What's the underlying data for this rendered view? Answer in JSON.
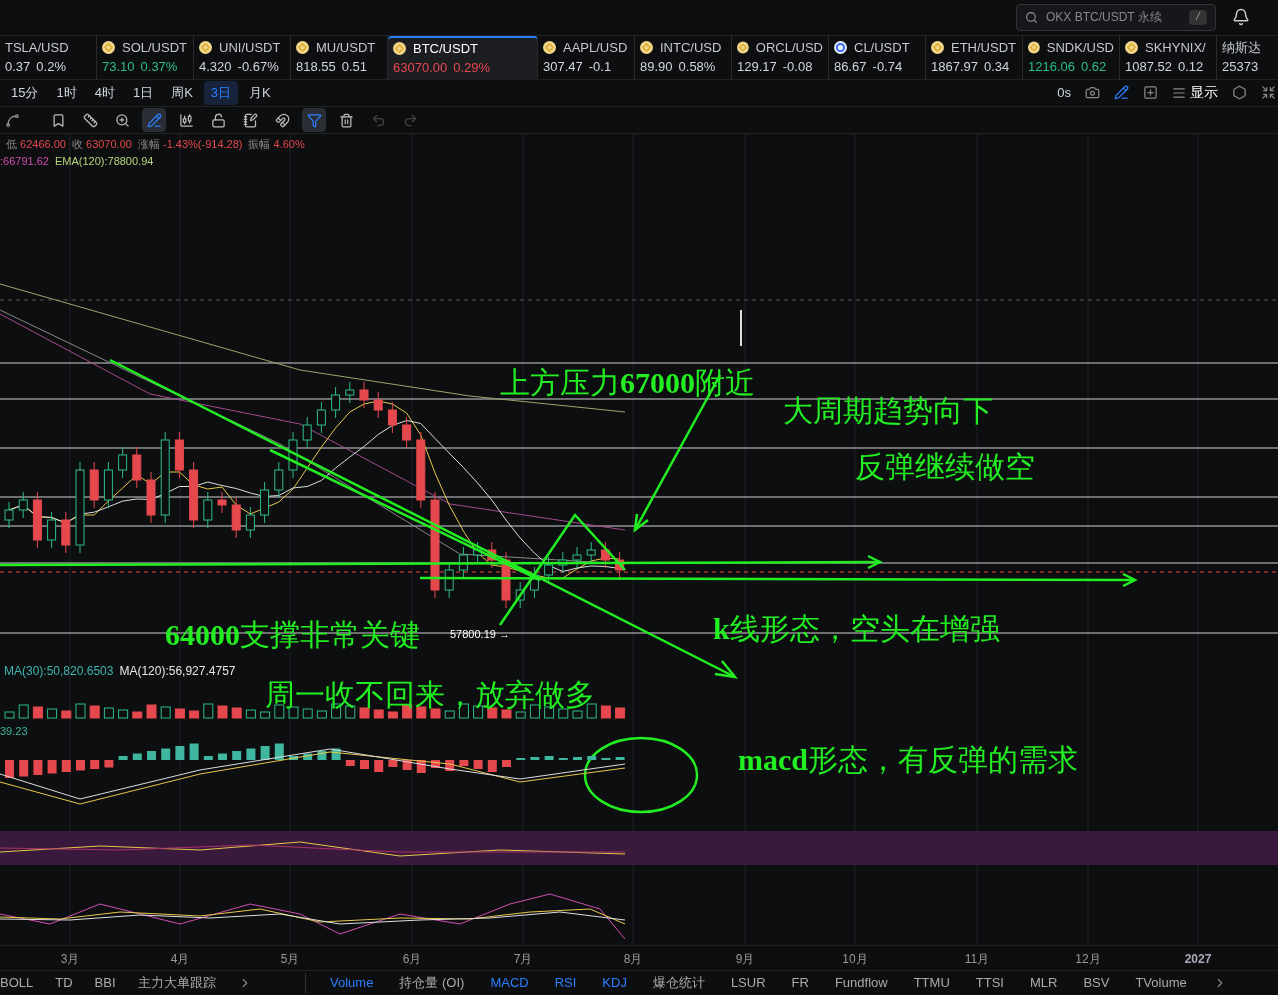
{
  "search": {
    "placeholder": "OKX BTC/USDT 永续",
    "shortcut": "/"
  },
  "tickers": [
    {
      "kind": "plain",
      "symbol": "TSLA/USD",
      "price": "0.37",
      "change": "0.2%",
      "selected": false,
      "color": "#d1d4dc"
    },
    {
      "kind": "coin",
      "symbol": "SOL/USDT",
      "price": "73.10",
      "change": "0.37%",
      "selected": false,
      "color": "#2ebd85"
    },
    {
      "kind": "coin",
      "symbol": "UNI/USDT",
      "price": "4.320",
      "change": "-0.67%",
      "selected": false,
      "color": "#d1d4dc"
    },
    {
      "kind": "coin",
      "symbol": "MU/USDT",
      "price": "818.55",
      "change": "0.51",
      "selected": false,
      "color": "#d1d4dc"
    },
    {
      "kind": "coin",
      "symbol": "BTC/USDT",
      "price": "63070.00",
      "change": "0.29%",
      "selected": true,
      "color": "#e5484d"
    },
    {
      "kind": "coin",
      "symbol": "AAPL/USD",
      "price": "307.47",
      "change": "-0.1",
      "selected": false,
      "color": "#d1d4dc"
    },
    {
      "kind": "coin",
      "symbol": "INTC/USD",
      "price": "89.90",
      "change": "0.58%",
      "selected": false,
      "color": "#d1d4dc"
    },
    {
      "kind": "coin",
      "symbol": "ORCL/USD",
      "price": "129.17",
      "change": "-0.08",
      "selected": false,
      "color": "#d1d4dc"
    },
    {
      "kind": "ring",
      "symbol": "CL/USDT",
      "price": "86.67",
      "change": "-0.74",
      "selected": false,
      "color": "#d1d4dc"
    },
    {
      "kind": "coin",
      "symbol": "ETH/USDT",
      "price": "1867.97",
      "change": "0.34",
      "selected": false,
      "color": "#d1d4dc"
    },
    {
      "kind": "coin",
      "symbol": "SNDK/USD",
      "price": "1216.06",
      "change": "0.62",
      "selected": false,
      "color": "#2ebd85"
    },
    {
      "kind": "coin",
      "symbol": "SKHYNIX/",
      "price": "1087.52",
      "change": "0.12",
      "selected": false,
      "color": "#d1d4dc"
    },
    {
      "kind": "plain",
      "symbol": "纳斯达",
      "price": "25373",
      "selected": false,
      "color": "#d1d4dc"
    }
  ],
  "timeframes": [
    {
      "label": "15分",
      "selected": false
    },
    {
      "label": "1时",
      "selected": false
    },
    {
      "label": "4时",
      "selected": false
    },
    {
      "label": "1日",
      "selected": false
    },
    {
      "label": "周K",
      "selected": false
    },
    {
      "label": "3日",
      "selected": true
    },
    {
      "label": "月K",
      "selected": false
    }
  ],
  "chart_controls": {
    "refresh": "0s",
    "display": "显示"
  },
  "drawing_tools": [
    {
      "kind": "line",
      "selected": false
    },
    {
      "kind": "bookmark",
      "selected": false
    },
    {
      "kind": "ruler",
      "selected": false
    },
    {
      "kind": "zoom",
      "selected": false
    },
    {
      "kind": "pen",
      "selected": true
    },
    {
      "kind": "candles",
      "selected": false
    },
    {
      "kind": "lock",
      "selected": false
    },
    {
      "kind": "note",
      "selected": false
    },
    {
      "kind": "magnet",
      "selected": false
    },
    {
      "kind": "filter",
      "selected": true
    },
    {
      "kind": "trash",
      "selected": false
    },
    {
      "kind": "undo",
      "selected": false
    },
    {
      "kind": "redo",
      "selected": false
    }
  ],
  "ohlc": [
    {
      "label": "低",
      "value": "62466.00"
    },
    {
      "label": "收",
      "value": "63070.00"
    },
    {
      "label": "涨幅",
      "value": "-1.43%(-914.28)"
    },
    {
      "label": "振幅",
      "value": "4.60%"
    }
  ],
  "ema": [
    {
      "text": ":66791.62",
      "color": "#d14fb0"
    },
    {
      "text": "EMA(120):78800.94",
      "color": "#b5d67a"
    }
  ],
  "annotations": [
    {
      "text": "上方压力**67000**附近"
    },
    {
      "text": "大周期趋势向下"
    },
    {
      "text": "反弹继续做空"
    },
    {
      "text": "**64000**支撑非常关键"
    },
    {
      "text": "**k**线形态，空头在增强"
    },
    {
      "text": "周一收不回来，放弃做多"
    },
    {
      "text": "**macd**形态，有反弹的需求"
    }
  ],
  "low_price_label": "57800.19 →",
  "volume_indicators": [
    {
      "text": "MA(30):50,820.6503",
      "color": "#3fb6b0"
    },
    {
      "text": "MA(120):56,927.4757",
      "color": "#e6e6e6"
    }
  ],
  "macd_value": "39.23",
  "x_axis": [
    {
      "label": "3月",
      "bold": false
    },
    {
      "label": "4月",
      "bold": false
    },
    {
      "label": "5月",
      "bold": false
    },
    {
      "label": "6月",
      "bold": false
    },
    {
      "label": "7月",
      "bold": false
    },
    {
      "label": "8月",
      "bold": false
    },
    {
      "label": "9月",
      "bold": false
    },
    {
      "label": "10月",
      "bold": false
    },
    {
      "label": "11月",
      "bold": false
    },
    {
      "label": "12月",
      "bold": false
    },
    {
      "label": "2027",
      "bold": true
    }
  ],
  "overlay_indicators": [
    {
      "label": "BOLL"
    },
    {
      "label": "TD"
    },
    {
      "label": "BBI"
    },
    {
      "label": "主力大单跟踪"
    }
  ],
  "sub_indicators": [
    {
      "label": "Volume",
      "selected": true
    },
    {
      "label": "持仓量 (OI)",
      "selected": false
    },
    {
      "label": "MACD",
      "selected": true
    },
    {
      "label": "RSI",
      "selected": true
    },
    {
      "label": "KDJ",
      "selected": true
    },
    {
      "label": "爆仓统计",
      "selected": false
    },
    {
      "label": "LSUR",
      "selected": false
    },
    {
      "label": "FR",
      "selected": false
    },
    {
      "label": "Fundflow",
      "selected": false
    },
    {
      "label": "TTMU",
      "selected": false
    },
    {
      "label": "TTSI",
      "selected": false
    },
    {
      "label": "MLR",
      "selected": false
    },
    {
      "label": "BSV",
      "selected": false
    },
    {
      "label": "TVolume",
      "selected": false
    }
  ]
}
